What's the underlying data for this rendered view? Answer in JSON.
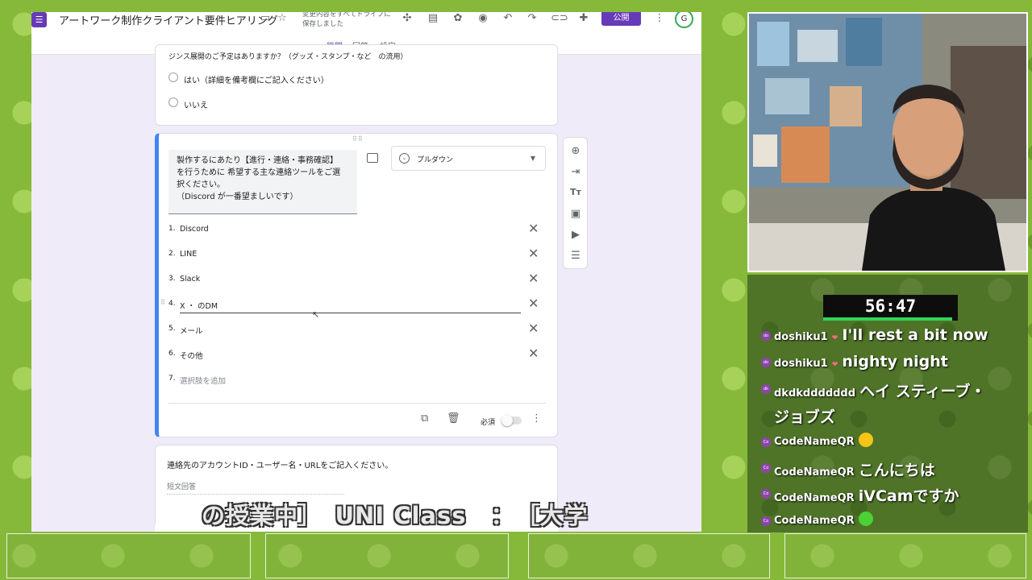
{
  "app": {
    "title": "アートワーク制作クライアント要件ヒアリング",
    "save_status": "変更内容をすべてドライブに保存しました",
    "publish": "公開",
    "tabs": [
      {
        "label": "質問"
      },
      {
        "label": "回答"
      },
      {
        "label": "設定"
      }
    ],
    "active_tab": "質問",
    "accent": "#673ab7"
  },
  "card1": {
    "partial_question": "ジンス展開のご予定はありますか？（グッズ・スタンプ・など　の流用）",
    "options": [
      "はい（詳細を備考欄にご記入ください）",
      "いいえ"
    ]
  },
  "card2": {
    "question": "製作するにあたり【進行・連絡・事務確認】\nを行うために 希望する主な連絡ツールをご選\n択ください。\n（Discord が一番望ましいです）",
    "type": "プルダウン",
    "options": [
      {
        "num": "1.",
        "label": "Discord"
      },
      {
        "num": "2.",
        "label": "LINE"
      },
      {
        "num": "3.",
        "label": "Slack"
      },
      {
        "num": "4.",
        "label": "X ・ のDM"
      },
      {
        "num": "5.",
        "label": "メール"
      },
      {
        "num": "6.",
        "label": "その他"
      }
    ],
    "add_option": {
      "num": "7.",
      "label": "選択肢を追加"
    },
    "required_label": "必須",
    "required": false
  },
  "card3": {
    "question": "連絡先のアカウントID・ユーザー名・URLをご記入ください。",
    "answer_hint": "短文回答"
  },
  "stream": {
    "timer": "56:47",
    "chat": [
      {
        "badge": "do",
        "user": "doshiku1",
        "heart": true,
        "text": "I'll rest a bit now"
      },
      {
        "badge": "do",
        "user": "doshiku1",
        "heart": true,
        "text": "nighty night"
      },
      {
        "badge": "dk",
        "user": "dkdkddddddd",
        "heart": false,
        "text": "ヘイ スティーブ・"
      },
      {
        "badge": "",
        "user": "",
        "heart": false,
        "text": "ジョブズ"
      },
      {
        "badge": "Co",
        "user": "CodeNameQR",
        "heart": false,
        "text": "",
        "emoji": "grinning-face",
        "emoji_color": "#f5c518"
      },
      {
        "badge": "Co",
        "user": "CodeNameQR",
        "heart": false,
        "text": "こんにちは"
      },
      {
        "badge": "Co",
        "user": "CodeNameQR",
        "heart": false,
        "text": "iVCamですか"
      },
      {
        "badge": "Co",
        "user": "CodeNameQR",
        "heart": false,
        "text": "",
        "emoji": "green-face",
        "emoji_color": "#4cd137"
      }
    ],
    "subtitle": "の授業中］　UNI Class　：　［大学"
  }
}
